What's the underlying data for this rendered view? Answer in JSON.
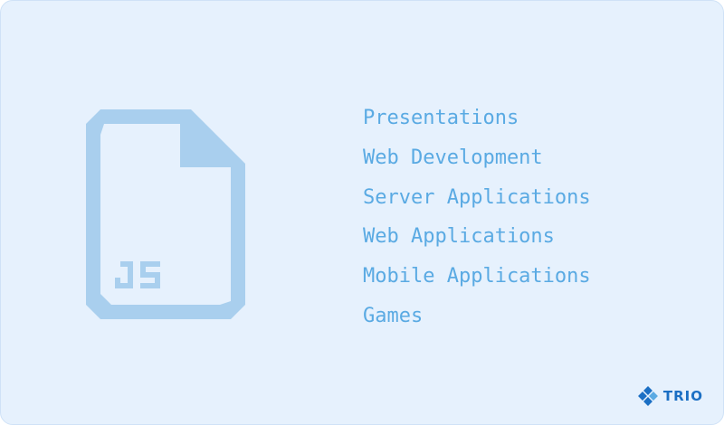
{
  "illustration": {
    "icon": "js-file-icon",
    "file_label": "JS",
    "color": "#a9cfee"
  },
  "uses": {
    "color": "#5aaae3",
    "items": [
      "Presentations",
      "Web Development",
      "Server Applications",
      "Web Applications",
      "Mobile Applications",
      "Games"
    ]
  },
  "brand": {
    "icon": "trio-logo-icon",
    "name": "TRIO",
    "color": "#1b6fc4"
  }
}
